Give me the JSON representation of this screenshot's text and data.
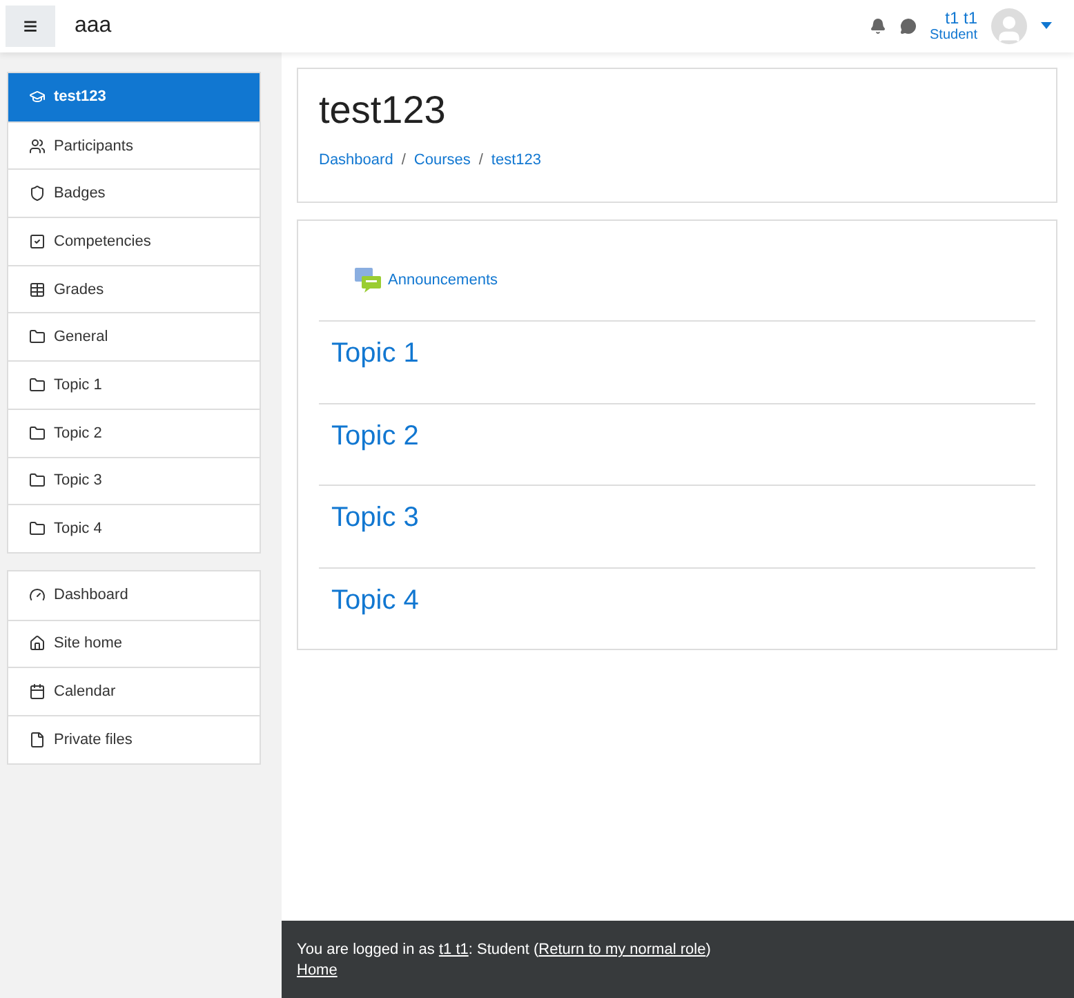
{
  "navbar": {
    "menu_icon": "≡",
    "site_name": "aaa",
    "user": {
      "name": "t1 t1",
      "role": "Student"
    }
  },
  "sidebar": {
    "groups": [
      [
        {
          "label": "test123",
          "kind": "course",
          "selected": true
        },
        {
          "label": "Participants",
          "kind": "users",
          "selected": false
        },
        {
          "label": "Badges",
          "kind": "shield",
          "selected": false
        },
        {
          "label": "Competencies",
          "kind": "check",
          "selected": false
        },
        {
          "label": "Grades",
          "kind": "table",
          "selected": false
        },
        {
          "label": "General",
          "kind": "folder",
          "selected": false
        },
        {
          "label": "Topic 1",
          "kind": "folder",
          "selected": false
        },
        {
          "label": "Topic 2",
          "kind": "folder",
          "selected": false
        },
        {
          "label": "Topic 3",
          "kind": "folder",
          "selected": false
        },
        {
          "label": "Topic 4",
          "kind": "folder",
          "selected": false
        }
      ],
      [
        {
          "label": "Dashboard",
          "kind": "gauge",
          "selected": false
        },
        {
          "label": "Site home",
          "kind": "home",
          "selected": false
        },
        {
          "label": "Calendar",
          "kind": "calendar",
          "selected": false
        },
        {
          "label": "Private files",
          "kind": "file",
          "selected": false
        }
      ]
    ]
  },
  "header": {
    "title": "test123",
    "breadcrumb": [
      "Dashboard",
      "Courses",
      "test123"
    ],
    "separator": "/"
  },
  "course": {
    "activity": "Announcements",
    "topics": [
      "Topic 1",
      "Topic 2",
      "Topic 3",
      "Topic 4"
    ]
  },
  "footer": {
    "prefix": "You are logged in as",
    "user_link": "t1 t1",
    "middle": ": Student (",
    "role_link": "Return to my normal role",
    "suffix": ")",
    "home_link": "Home"
  }
}
